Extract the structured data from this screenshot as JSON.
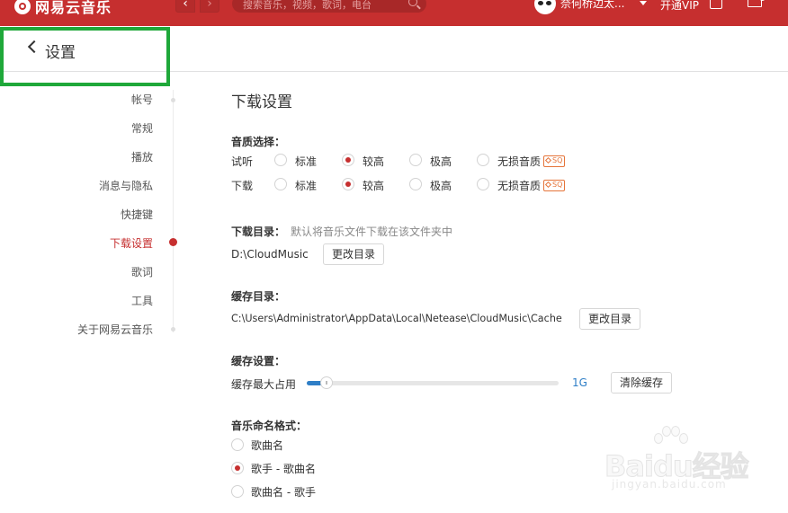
{
  "topbar": {
    "app_name": "网易云音乐",
    "nav_back": "‹",
    "nav_forward": "›",
    "search_placeholder": "搜索音乐，视频，歌词，电台",
    "username": "奈何桥边太...",
    "vip_label": "开通VIP",
    "icons": [
      "netease-logo-icon",
      "search-icon",
      "shirt-icon",
      "mail-icon"
    ]
  },
  "header": {
    "title": "设置"
  },
  "sidebar": {
    "items": [
      {
        "label": "帐号",
        "active": false
      },
      {
        "label": "常规",
        "active": false
      },
      {
        "label": "播放",
        "active": false
      },
      {
        "label": "消息与隐私",
        "active": false
      },
      {
        "label": "快捷键",
        "active": false
      },
      {
        "label": "下载设置",
        "active": true
      },
      {
        "label": "歌词",
        "active": false
      },
      {
        "label": "工具",
        "active": false
      },
      {
        "label": "关于网易云音乐",
        "active": false
      }
    ]
  },
  "content": {
    "section_title": "下载设置",
    "quality": {
      "label": "音质选择：",
      "rows": [
        {
          "name": "试听",
          "selected": "较高"
        },
        {
          "name": "下载",
          "selected": "较高"
        }
      ],
      "options": [
        "标准",
        "较高",
        "极高",
        "无损音质"
      ],
      "sq_badge": "SQ"
    },
    "download_dir": {
      "label": "下载目录：",
      "hint": "默认将音乐文件下载在该文件夹中",
      "path": "D:\\CloudMusic",
      "button": "更改目录"
    },
    "cache_dir": {
      "label": "缓存目录：",
      "path": "C:\\Users\\Administrator\\AppData\\Local\\Netease\\CloudMusic\\Cache",
      "button": "更改目录"
    },
    "cache_settings": {
      "label": "缓存设置：",
      "max_label": "缓存最大占用",
      "value_text": "1G",
      "slider_fraction": 0.08,
      "button": "清除缓存"
    },
    "naming": {
      "label": "音乐命名格式：",
      "options": [
        "歌曲名",
        "歌手 - 歌曲名",
        "歌曲名 - 歌手"
      ],
      "selected_index": 1
    }
  },
  "watermark": {
    "brand": "Baidu经验",
    "url": "jingyan.baidu.com"
  },
  "colors": {
    "brand_red": "#c62f2f",
    "accent_blue": "#2f7fc7",
    "highlight_green": "#1fa83a"
  }
}
